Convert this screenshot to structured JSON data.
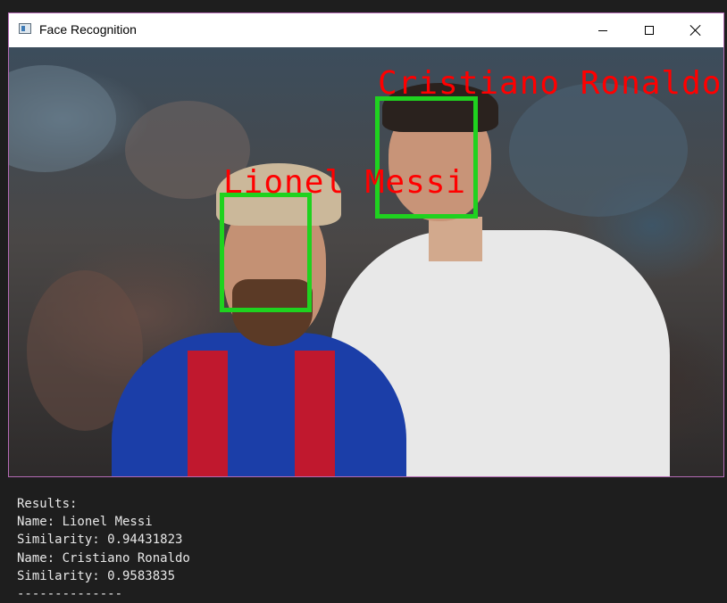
{
  "window": {
    "title": "Face Recognition",
    "icon": "app-window-icon",
    "controls": [
      "minimize-icon",
      "maximize-icon",
      "close-icon"
    ]
  },
  "image": {
    "description_icon": "photo-image",
    "detections": [
      {
        "name": "Cristiano Ronaldo"
      },
      {
        "name": "Lionel Messi"
      }
    ],
    "colors": {
      "box": "#1fd21f",
      "label": "#ff0000"
    }
  },
  "console": {
    "lines": [
      "Results:",
      "Name: Lionel Messi",
      "Similarity: 0.94431823",
      "Name: Cristiano Ronaldo",
      "Similarity: 0.9583835",
      "--------------"
    ]
  }
}
